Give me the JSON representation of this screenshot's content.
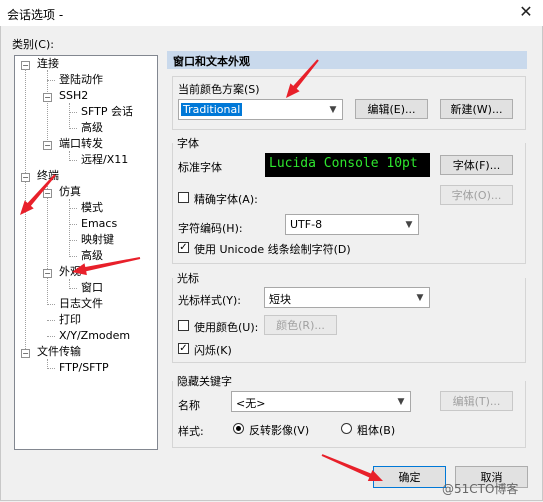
{
  "window": {
    "title": "会话选项 -",
    "close_glyph": "✕"
  },
  "category_label": "类别(C):",
  "tree": {
    "items": [
      "连接",
      "登陆动作",
      "SSH2",
      "SFTP 会话",
      "高级",
      "端口转发",
      "远程/X11",
      "终端",
      "仿真",
      "模式",
      "Emacs",
      "映射键",
      "高级",
      "外观",
      "窗口",
      "日志文件",
      "打印",
      "X/Y/Zmodem",
      "文件传输",
      "FTP/SFTP"
    ]
  },
  "panel": {
    "header": "窗口和文本外观",
    "scheme": {
      "label": "当前颜色方案(S)",
      "value": "Traditional",
      "edit_button": "编辑(E)...",
      "new_button": "新建(W)..."
    },
    "font": {
      "group_title": "字体",
      "standard_label": "标准字体",
      "preview": "Lucida Console 10pt",
      "font_button": "字体(F)...",
      "precise_label": "精确字体(A):",
      "precise_checked": false,
      "precise_button": "字体(O)...",
      "encoding_label": "字符编码(H):",
      "encoding_value": "UTF-8",
      "unicode_label": "使用 Unicode 线条绘制字符(D)",
      "unicode_checked": true
    },
    "cursor": {
      "group_title": "光标",
      "style_label": "光标样式(Y):",
      "style_value": "短块",
      "use_color_label": "使用颜色(U):",
      "use_color_checked": false,
      "color_button": "颜色(R)...",
      "blink_label": "闪烁(K)",
      "blink_checked": true
    },
    "hidden_keyword": {
      "group_title": "隐藏关键字",
      "name_label": "名称",
      "name_value": "<无>",
      "edit_button": "编辑(T)...",
      "style_label": "样式:",
      "reverse_label": "反转影像(V)",
      "bold_label": "粗体(B)",
      "selected": "reverse"
    }
  },
  "footer": {
    "ok_button": "确定",
    "cancel_button": "取消"
  },
  "watermark": "@51CTO博客",
  "colors": {
    "annotation_arrow": "#e8202a",
    "panel_header": "#c9d9ec",
    "selection": "#0078d7"
  }
}
